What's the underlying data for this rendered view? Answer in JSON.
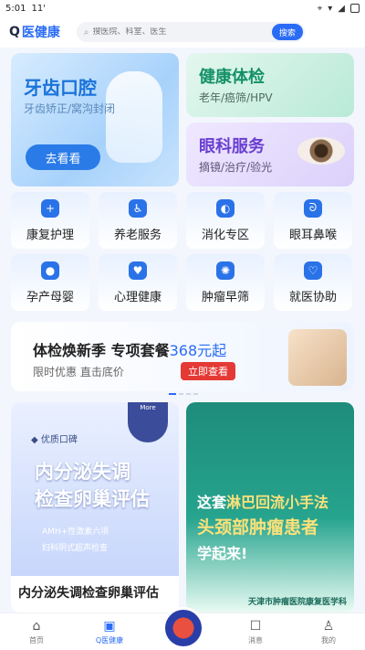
{
  "status_bar": {
    "time": "5:01",
    "extra": "11'"
  },
  "header": {
    "logo_prefix": "Q",
    "logo_text": "医健康",
    "search_placeholder": "搜医院、科室、医生",
    "search_button": "搜索"
  },
  "feature_cards": {
    "teeth": {
      "title": "牙齿口腔",
      "subtitle": "牙齿矫正/窝沟封闭",
      "button": "去看看"
    },
    "check": {
      "title": "健康体检",
      "subtitle": "老年/癌筛/HPV"
    },
    "eye": {
      "title": "眼科服务",
      "subtitle": "摘镜/治疗/验光"
    }
  },
  "grid": [
    {
      "label": "康复护理",
      "icon": "medical-bag-icon"
    },
    {
      "label": "养老服务",
      "icon": "elderly-icon"
    },
    {
      "label": "消化专区",
      "icon": "stomach-icon"
    },
    {
      "label": "眼耳鼻喉",
      "icon": "ear-icon"
    },
    {
      "label": "孕产母婴",
      "icon": "pregnancy-icon"
    },
    {
      "label": "心理健康",
      "icon": "heart-icon"
    },
    {
      "label": "肿瘤早筛",
      "icon": "cell-icon"
    },
    {
      "label": "就医协助",
      "icon": "handshake-icon"
    }
  ],
  "banner": {
    "title": "体检焕新季 专项套餐",
    "price": "368元起",
    "subtitle": "限时优惠  直击底价",
    "button": "立即查看"
  },
  "promo_left": {
    "badge": "优质口碑",
    "more": "More",
    "title_line1": "内分泌失调",
    "title_line2": "检查卵巢评估",
    "bullet1": "AMH+性激素六项",
    "bullet2": "妇科阴式超声检查",
    "caption": "内分泌失调检查卵巢评估"
  },
  "promo_right": {
    "line1_prefix": "这套",
    "line1_highlight": "淋巴回流小手法",
    "line2": "头颈部肿瘤患者",
    "line3": "学起来!",
    "footer": "天津市肿瘤医院康复医学科"
  },
  "tabbar": [
    {
      "label": "首页",
      "icon": "home-icon"
    },
    {
      "label": "Q医健康",
      "icon": "medkit-icon"
    },
    {
      "label": "",
      "icon": ""
    },
    {
      "label": "消息",
      "icon": "message-icon"
    },
    {
      "label": "我的",
      "icon": "user-icon"
    }
  ]
}
